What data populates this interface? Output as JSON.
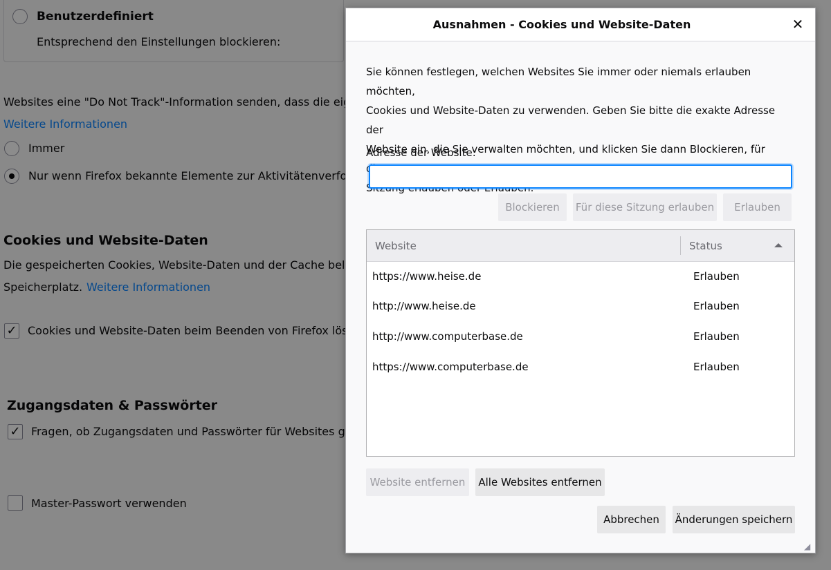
{
  "background": {
    "custom_option_label": "Benutzerdefiniert",
    "custom_option_desc": "Entsprechend den Einstellungen blockieren:",
    "dnt_text": "Websites eine \"Do Not Track\"-Information senden, dass die eige",
    "dnt_more_info": "Weitere Informationen",
    "dnt_always": "Immer",
    "dnt_only_when": "Nur wenn Firefox bekannte Elemente zur Aktivitätenverfolg",
    "cookies_heading": "Cookies und Website-Daten",
    "cookies_text_line1": "Die gespeicherten Cookies, Website-Daten und der Cache belege",
    "cookies_text_line2": "Speicherplatz.",
    "cookies_more_info": "Weitere Informationen",
    "cookies_delete_on_exit": "Cookies und Website-Daten beim Beenden von Firefox lösch",
    "logins_heading": "Zugangsdaten & Passwörter",
    "logins_ask": "Fragen, ob Zugangsdaten und Passwörter für Websites ges",
    "master_password": "Master-Passwort verwenden"
  },
  "dialog": {
    "title": "Ausnahmen - Cookies und Website-Daten",
    "close_icon": "close-icon",
    "description": [
      "Sie können festlegen, welchen Websites Sie immer oder niemals erlauben möchten,",
      "Cookies und Website-Daten zu verwenden. Geben Sie bitte die exakte Adresse der",
      "Website ein, die Sie verwalten möchten, und klicken Sie dann Blockieren, für diese",
      "Sitzung erlauben oder Erlauben."
    ],
    "address_label": "Adresse der Website:",
    "address_value": "",
    "buttons": {
      "block": "Blockieren",
      "allow_session": "Für diese Sitzung erlauben",
      "allow": "Erlauben",
      "remove_website": "Website entfernen",
      "remove_all": "Alle Websites entfernen",
      "cancel": "Abbrechen",
      "save": "Änderungen speichern"
    },
    "table": {
      "columns": [
        "Website",
        "Status"
      ],
      "sort_column": "Status",
      "rows": [
        {
          "website": "https://www.heise.de",
          "status": "Erlauben"
        },
        {
          "website": "http://www.heise.de",
          "status": "Erlauben"
        },
        {
          "website": "http://www.computerbase.de",
          "status": "Erlauben"
        },
        {
          "website": "https://www.computerbase.de",
          "status": "Erlauben"
        }
      ]
    }
  },
  "colors": {
    "link": "#0a84ff",
    "focus": "#0a84ff",
    "dialog_bg": "#f9f9fa",
    "button_bg": "#e7e7e8"
  }
}
